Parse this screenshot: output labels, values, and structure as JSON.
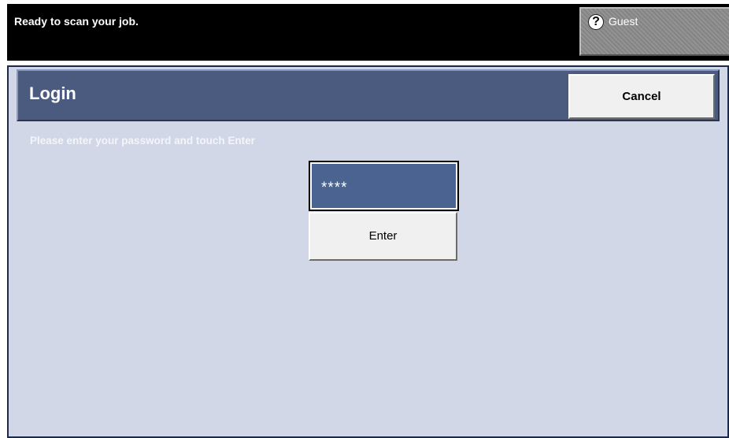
{
  "status_bar": {
    "message": "Ready to scan your job.",
    "user_button_label": "Guest",
    "user_icon_glyph": "?",
    "user_icon_name": "help-icon"
  },
  "dialog": {
    "title": "Login",
    "cancel_label": "Cancel",
    "instruction": "Please enter your password and touch Enter",
    "password_value": "****",
    "enter_label": "Enter"
  },
  "colors": {
    "status_bar_bg": "#000000",
    "title_bar_bg": "#4b5b7f",
    "panel_bg": "#d1d7e6",
    "password_field_bg": "#4b6391",
    "button_bg": "#f0f0f0"
  }
}
